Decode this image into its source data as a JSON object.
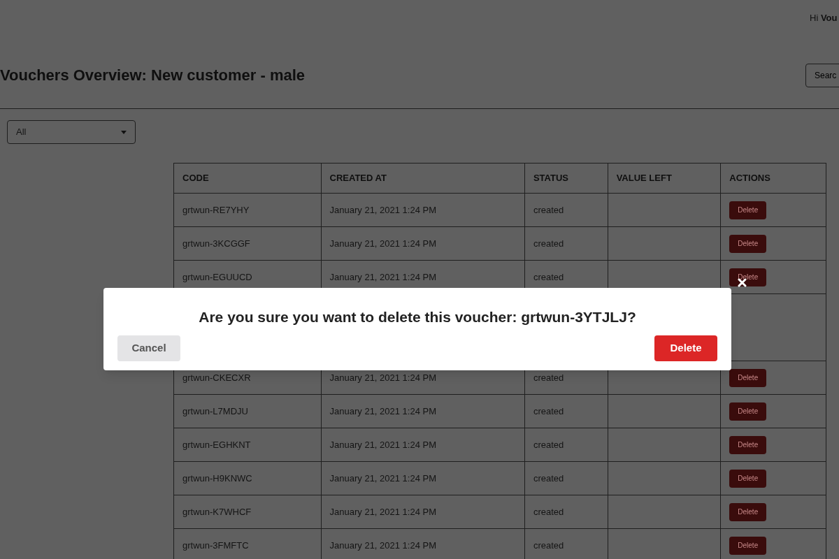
{
  "header": {
    "greeting": "Hi **Vou**"
  },
  "page": {
    "title": "Vouchers Overview: New customer - male",
    "search": {
      "placeholder": "Searc"
    },
    "filter": {
      "value": "All"
    }
  },
  "table": {
    "columns": [
      "CODE",
      "CREATED AT",
      "STATUS",
      "VALUE LEFT",
      "ACTIONS"
    ],
    "rows": [
      {
        "code": "grtwun-RE7YHY",
        "created_at": "January 21, 2021 1:24 PM",
        "status": "created",
        "action": "Delete"
      },
      {
        "code": "grtwun-3KCGGF",
        "created_at": "January 21, 2021 1:24 PM",
        "status": "created",
        "action": "Delete"
      },
      {
        "code": "grtwun-EGUUCD",
        "created_at": "January 21, 2021 1:24 PM",
        "status": "created",
        "action": "Delete"
      },
      {
        "code": "grtwun-CKECXR",
        "created_at": "January 21, 2021 1:24 PM",
        "status": "created",
        "action": "Delete"
      },
      {
        "code": "grtwun-L7MDJU",
        "created_at": "January 21, 2021 1:24 PM",
        "status": "created",
        "action": "Delete"
      },
      {
        "code": "grtwun-EGHKNT",
        "created_at": "January 21, 2021 1:24 PM",
        "status": "created",
        "action": "Delete"
      },
      {
        "code": "grtwun-H9KNWC",
        "created_at": "January 21, 2021 1:24 PM",
        "status": "created",
        "action": "Delete"
      },
      {
        "code": "grtwun-K7WHCF",
        "created_at": "January 21, 2021 1:24 PM",
        "status": "created",
        "action": "Delete"
      },
      {
        "code": "grtwun-3FMFTC",
        "created_at": "January 21, 2021 1:24 PM",
        "status": "created",
        "action": "Delete"
      }
    ]
  },
  "dialog": {
    "message": "Are you sure you want to delete this voucher: grtwun-3YTJLJ?",
    "buttons": [
      {
        "label": "Cancel",
        "kind": "secondary"
      },
      {
        "label": "Delete",
        "kind": "danger"
      }
    ]
  }
}
